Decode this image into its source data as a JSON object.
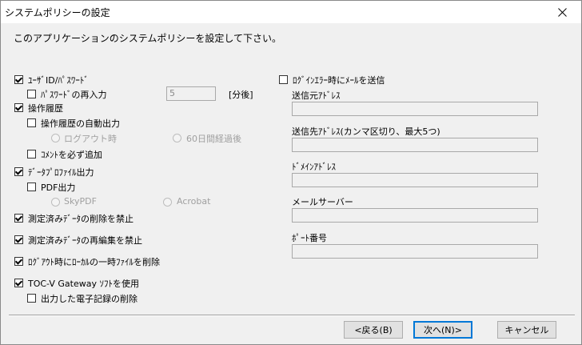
{
  "window": {
    "title": "システムポリシーの設定"
  },
  "intro": "このアプリケーションのシステムポリシーを設定して下さい。",
  "left": {
    "userid_password": {
      "label": "ﾕｰｻﾞID/ﾊﾟｽﾜｰﾄﾞ",
      "checked": true
    },
    "password_reentry": {
      "label": "ﾊﾟｽﾜｰﾄﾞの再入力",
      "checked": false,
      "minutes_value": "5",
      "minutes_unit": "[分後]"
    },
    "operation_history": {
      "label": "操作履歴",
      "checked": true
    },
    "history_auto_output": {
      "label": "操作履歴の自動出力",
      "checked": false
    },
    "radio_logout": "ログアウト時",
    "radio_60days": "60日間経過後",
    "comment_required": {
      "label": "ｺﾒﾝﾄを必ず追加",
      "checked": false
    },
    "data_profile_output": {
      "label": "ﾃﾞｰﾀﾌﾟﾛﾌｧｲﾙ出力",
      "checked": true
    },
    "pdf_output": {
      "label": "PDF出力",
      "checked": false
    },
    "radio_skypdf": "SkyPDF",
    "radio_acrobat": "Acrobat",
    "prohibit_delete": {
      "label": "測定済みﾃﾞｰﾀの削除を禁止",
      "checked": true
    },
    "prohibit_reedit": {
      "label": "測定済みﾃﾞｰﾀの再編集を禁止",
      "checked": true
    },
    "delete_temp_on_logout": {
      "label": "ﾛｸﾞｱｳﾄ時にﾛｰｶﾙの一時ﾌｧｲﾙを削除",
      "checked": true
    },
    "use_toc_gateway": {
      "label": "TOC-V Gateway ｿﾌﾄを使用",
      "checked": true
    },
    "delete_output_records": {
      "label": "出力した電子記録の削除",
      "checked": false
    }
  },
  "right": {
    "login_error_mail": {
      "label": "ﾛｸﾞｲﾝｴﾗｰ時にﾒｰﾙを送信",
      "checked": false
    },
    "sender_label": "送信元ｱﾄﾞﾚｽ",
    "recipient_label": "送信先ｱﾄﾞﾚｽ(カンマ区切り、最大5つ)",
    "domain_label": "ﾄﾞﾒｲﾝｱﾄﾞﾚｽ",
    "mailserver_label": "メールサーバー",
    "port_label": "ﾎﾟｰﾄ番号"
  },
  "buttons": {
    "back": "<戻る(B)",
    "next": "次へ(N)>",
    "cancel": "キャンセル"
  },
  "icons": {
    "close": "close-icon"
  }
}
